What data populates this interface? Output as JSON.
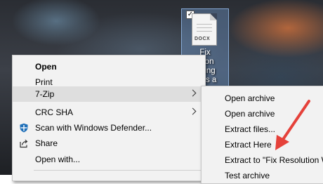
{
  "desktop": {
    "icon": {
      "extension": "DOCX",
      "label_lines": [
        "Fix",
        "ution",
        "Using",
        "V as a"
      ],
      "checked": true
    }
  },
  "context_menu": {
    "items": [
      {
        "label": "Open",
        "bold": true
      },
      {
        "label": "Print"
      },
      {
        "label": "7-Zip",
        "submenu": true,
        "highlighted": true
      },
      {
        "label": "CRC SHA",
        "submenu": true
      },
      {
        "label": "Scan with Windows Defender...",
        "icon": "windows-defender-icon"
      },
      {
        "label": "Share",
        "icon": "share-icon"
      },
      {
        "label": "Open with..."
      }
    ]
  },
  "submenu_7zip": {
    "items": [
      {
        "label": "Open archive"
      },
      {
        "label": "Open archive"
      },
      {
        "label": "Extract files..."
      },
      {
        "label": "Extract Here"
      },
      {
        "label": "Extract to \"Fix Resolution W"
      },
      {
        "label": "Test archive"
      }
    ]
  },
  "annotation": {
    "color": "#e5413a",
    "icon": "red-arrow-pointer"
  },
  "colors": {
    "menu_bg": "#f2f2f2",
    "highlight": "#dedede",
    "defender_blue": "#1f6fb8"
  }
}
